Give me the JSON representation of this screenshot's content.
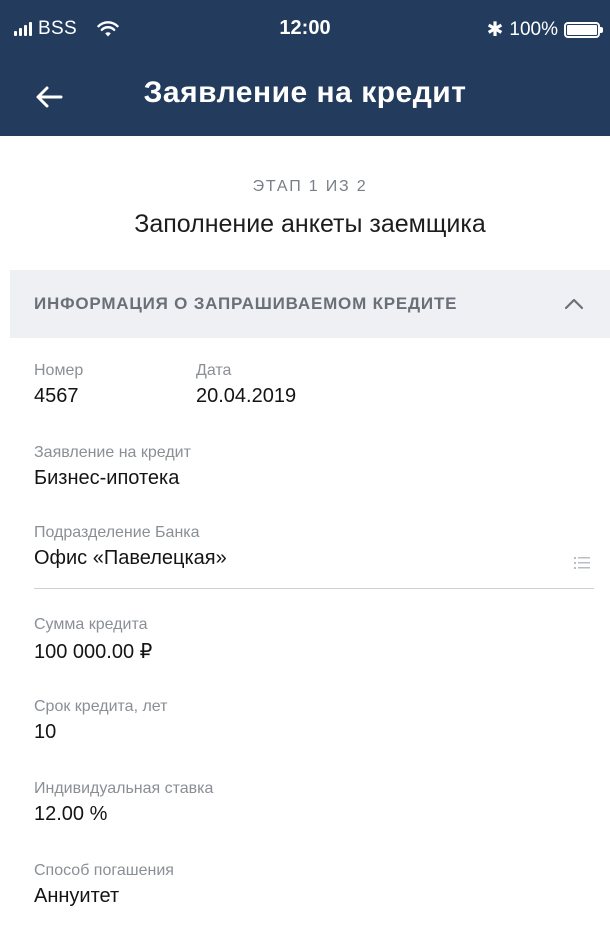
{
  "status_bar": {
    "carrier": "BSS",
    "time": "12:00",
    "battery": "100%",
    "bluetooth_icon": "bluetooth-icon",
    "wifi_icon": "wifi-icon"
  },
  "nav": {
    "title": "Заявление на кредит",
    "back_icon": "arrow-left-icon"
  },
  "step": {
    "label": "ЭТАП 1 ИЗ 2",
    "title": "Заполнение анкеты заемщика"
  },
  "section": {
    "title": "ИНФОРМАЦИЯ О ЗАПРАШИВАЕМОМ КРЕДИТЕ",
    "toggle_icon": "chevron-up-icon"
  },
  "fields": {
    "number": {
      "label": "Номер",
      "value": "4567"
    },
    "date": {
      "label": "Дата",
      "value": "20.04.2019"
    },
    "application": {
      "label": "Заявление на кредит",
      "value": "Бизнес-ипотека"
    },
    "branch": {
      "label": "Подразделение Банка",
      "value": "Офис  «Павелецкая»"
    },
    "amount": {
      "label": "Сумма кредита",
      "value": "100 000.00 ₽"
    },
    "term": {
      "label": "Срок кредита, лет",
      "value": "10"
    },
    "rate": {
      "label": "Индивидуальная ставка",
      "value": "12.00 %"
    },
    "repayment": {
      "label": "Способ погашения",
      "value": "Аннуитет"
    }
  },
  "colors": {
    "header_bg": "#233c5e",
    "section_bg": "#eef0f3",
    "label_gray": "#8a8f96"
  }
}
